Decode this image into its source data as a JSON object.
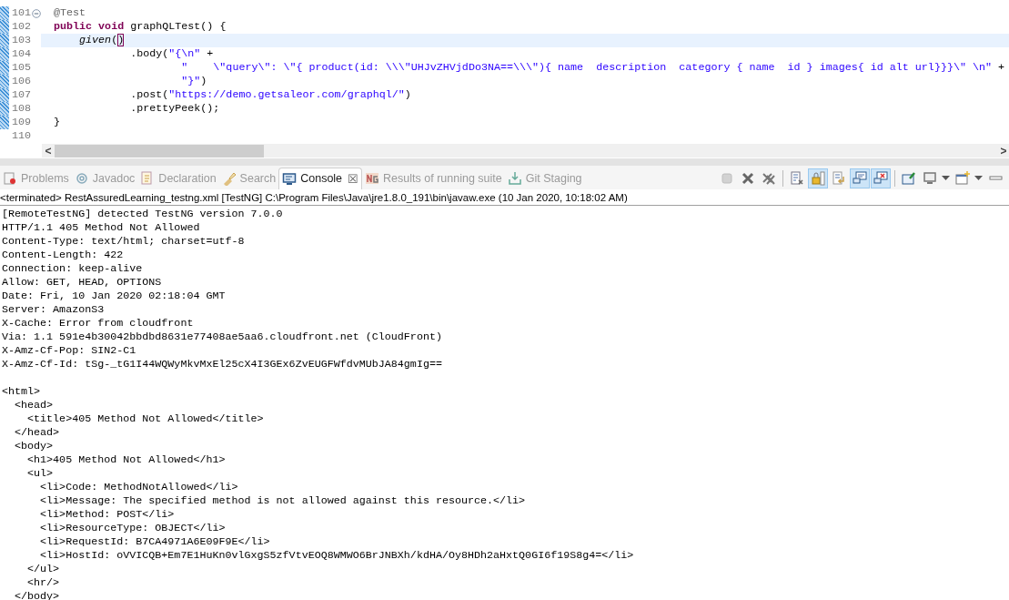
{
  "editor": {
    "lines": [
      {
        "number": "101",
        "changed": true,
        "current": false,
        "foldable": true,
        "tokens": [
          {
            "text": "@Test",
            "kind": "annotation"
          }
        ]
      },
      {
        "number": "102",
        "changed": true,
        "current": false,
        "tokens": [
          {
            "text": "public",
            "kind": "keyword"
          },
          {
            "text": " void",
            "kind": "keyword"
          },
          {
            "text": " graphQLTest() {",
            "kind": "plain"
          }
        ]
      },
      {
        "number": "103",
        "changed": true,
        "current": true,
        "tokens": [
          {
            "text": "    given",
            "kind": "static_method"
          },
          {
            "text": "(",
            "kind": "plain"
          },
          {
            "text": ")",
            "kind": "matched_bracket"
          }
        ]
      },
      {
        "number": "104",
        "changed": true,
        "current": false,
        "tokens": [
          {
            "text": "            .body(",
            "kind": "plain"
          },
          {
            "text": "\"{\\n\"",
            "kind": "string"
          },
          {
            "text": " +",
            "kind": "plain"
          }
        ]
      },
      {
        "number": "105",
        "changed": true,
        "current": false,
        "tokens": [
          {
            "text": "                    \"    \\\"query\\\": \\\"{ product(id: \\\\\\\"UHJvZHVjdDo3NA==\\\\\\\"){ name  description  category { name  id } images{ id alt url}}}\\\" \\n\"",
            "kind": "string"
          },
          {
            "text": " +",
            "kind": "plain"
          }
        ]
      },
      {
        "number": "106",
        "changed": true,
        "current": false,
        "tokens": [
          {
            "text": "                    \"}\"",
            "kind": "string"
          },
          {
            "text": ")",
            "kind": "plain"
          }
        ]
      },
      {
        "number": "107",
        "changed": true,
        "current": false,
        "tokens": [
          {
            "text": "            .post(",
            "kind": "plain"
          },
          {
            "text": "\"https://demo.getsaleor.com/graphql/\"",
            "kind": "string"
          },
          {
            "text": ")",
            "kind": "plain"
          }
        ]
      },
      {
        "number": "108",
        "changed": true,
        "current": false,
        "tokens": [
          {
            "text": "            .prettyPeek();",
            "kind": "plain"
          }
        ]
      },
      {
        "number": "109",
        "changed": true,
        "current": false,
        "tokens": [
          {
            "text": "}",
            "kind": "plain"
          }
        ]
      },
      {
        "number": "110",
        "changed": false,
        "current": false
      }
    ],
    "scroll_arrows": [
      "<",
      ">"
    ]
  },
  "tabs": [
    {
      "label": "Problems",
      "kind": "problems",
      "selected": false
    },
    {
      "label": "Javadoc",
      "kind": "javadoc",
      "selected": false
    },
    {
      "label": "Declaration",
      "kind": "declaration",
      "selected": false
    },
    {
      "label": "Search",
      "kind": "search",
      "selected": false
    },
    {
      "label": "Console",
      "kind": "console",
      "selected": true,
      "close": "☒"
    },
    {
      "label": "Results of running suite",
      "kind": "testng",
      "selected": false
    },
    {
      "label": "Git Staging",
      "kind": "git",
      "selected": false
    }
  ],
  "toolbar": [
    {
      "kind": "terminate",
      "pressed": false,
      "disabled": true
    },
    {
      "kind": "remove",
      "pressed": false,
      "disabled": false
    },
    {
      "kind": "remove_all",
      "pressed": false,
      "disabled": false
    },
    {
      "kind": "sep"
    },
    {
      "kind": "clear",
      "pressed": false,
      "disabled": false
    },
    {
      "kind": "scroll_lock",
      "pressed": true,
      "disabled": false
    },
    {
      "kind": "word_wrap",
      "pressed": false,
      "disabled": false
    },
    {
      "kind": "stdout",
      "pressed": true,
      "disabled": false
    },
    {
      "kind": "stderr",
      "pressed": true,
      "disabled": false
    },
    {
      "kind": "sep"
    },
    {
      "kind": "pin",
      "pressed": false,
      "disabled": false
    },
    {
      "kind": "display",
      "pressed": false,
      "disabled": false,
      "dropdown": true
    },
    {
      "kind": "open_console",
      "pressed": false,
      "disabled": false,
      "dropdown": true
    },
    {
      "kind": "minimize",
      "pressed": false,
      "disabled": false
    }
  ],
  "console": {
    "header": "<terminated> RestAssuredLearning_testng.xml [TestNG] C:\\Program Files\\Java\\jre1.8.0_191\\bin\\javaw.exe (10 Jan 2020, 10:18:02 AM)",
    "blocks": [
      [
        "[RemoteTestNG] detected TestNG version 7.0.0",
        "HTTP/1.1 405 Method Not Allowed",
        "Content-Type: text/html; charset=utf-8",
        "Content-Length: 422",
        "Connection: keep-alive",
        "Allow: GET, HEAD, OPTIONS",
        "Date: Fri, 10 Jan 2020 02:18:04 GMT",
        "Server: AmazonS3",
        "X-Cache: Error from cloudfront",
        "Via: 1.1 591e4b30042bbdbd8631e77408ae5aa6.cloudfront.net (CloudFront)",
        "X-Amz-Cf-Pop: SIN2-C1",
        "X-Amz-Cf-Id: tSg-_tG1I44WQWyMkvMxEl25cX4I3GEx6ZvEUGFWfdvMUbJA84gmIg=="
      ],
      [
        "<html>",
        "  <head>",
        "    <title>405 Method Not Allowed</title>",
        "  </head>",
        "  <body>",
        "    <h1>405 Method Not Allowed</h1>",
        "    <ul>",
        "      <li>Code: MethodNotAllowed</li>",
        "      <li>Message: The specified method is not allowed against this resource.</li>",
        "      <li>Method: POST</li>",
        "      <li>ResourceType: OBJECT</li>",
        "      <li>RequestId: B7CA4971A6E09F9E</li>",
        "      <li>HostId: oVVICQB+Em7E1HuKn0vlGxgS5zfVtvEOQ8WMWO6BrJNBXh/kdHA/Oy8HDh2aHxtQ0GI6f19S8g4=</li>",
        "    </ul>",
        "    <hr/>",
        "  </body>"
      ]
    ]
  }
}
